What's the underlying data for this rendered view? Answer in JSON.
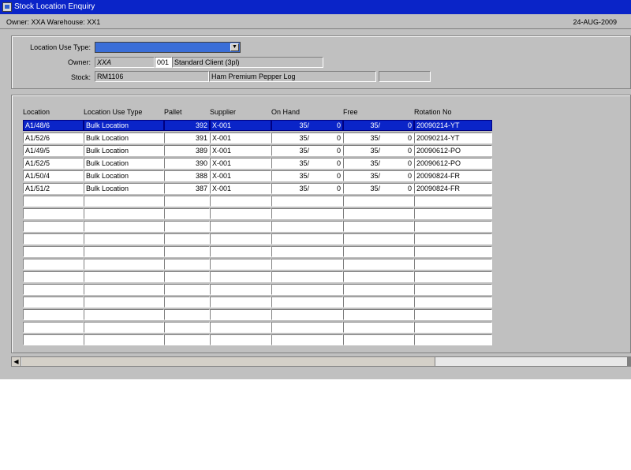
{
  "window": {
    "title": "Stock Location Enquiry"
  },
  "infobar": {
    "owner_text": "Owner:  XXA    Warehouse:  XX1",
    "date": "24-AUG-2009"
  },
  "criteria": {
    "location_use_type_label": "Location Use Type:",
    "location_use_type_value": "",
    "owner_label": "Owner:",
    "owner_code": "XXA",
    "client_code": "001",
    "client_name": "Standard Client (3pl)",
    "stock_label": "Stock:",
    "stock_code": "RM1106",
    "stock_description": "Ham Premium Pepper Log",
    "stock_extra": ""
  },
  "grid": {
    "columns": [
      "Location",
      "Location Use Type",
      "Pallet",
      "Supplier",
      "On Hand",
      "Free",
      "Rotation No"
    ],
    "rows": [
      {
        "location": "A1/48/6",
        "use_type": "Bulk Location",
        "pallet": "392",
        "supplier": "X-001",
        "onhand_a": "35/",
        "onhand_b": "0",
        "free_a": "35/",
        "free_b": "0",
        "rotation": "20090214-YT",
        "selected": true
      },
      {
        "location": "A1/52/6",
        "use_type": "Bulk Location",
        "pallet": "391",
        "supplier": "X-001",
        "onhand_a": "35/",
        "onhand_b": "0",
        "free_a": "35/",
        "free_b": "0",
        "rotation": "20090214-YT",
        "selected": false
      },
      {
        "location": "A1/49/5",
        "use_type": "Bulk Location",
        "pallet": "389",
        "supplier": "X-001",
        "onhand_a": "35/",
        "onhand_b": "0",
        "free_a": "35/",
        "free_b": "0",
        "rotation": "20090612-PO",
        "selected": false
      },
      {
        "location": "A1/52/5",
        "use_type": "Bulk Location",
        "pallet": "390",
        "supplier": "X-001",
        "onhand_a": "35/",
        "onhand_b": "0",
        "free_a": "35/",
        "free_b": "0",
        "rotation": "20090612-PO",
        "selected": false
      },
      {
        "location": "A1/50/4",
        "use_type": "Bulk Location",
        "pallet": "388",
        "supplier": "X-001",
        "onhand_a": "35/",
        "onhand_b": "0",
        "free_a": "35/",
        "free_b": "0",
        "rotation": "20090824-FR",
        "selected": false
      },
      {
        "location": "A1/51/2",
        "use_type": "Bulk Location",
        "pallet": "387",
        "supplier": "X-001",
        "onhand_a": "35/",
        "onhand_b": "0",
        "free_a": "35/",
        "free_b": "0",
        "rotation": "20090824-FR",
        "selected": false
      }
    ],
    "total_rows": 18
  },
  "colors": {
    "titlebar": "#0a24c8",
    "selection": "#0a24c8",
    "form_bg": "#c0c0c0",
    "dropdown": "#3a6ed8"
  },
  "icons": {
    "app": "app-icon",
    "dropdown": "dropdown-arrow-icon",
    "scroll_left": "scroll-left-arrow-icon"
  }
}
